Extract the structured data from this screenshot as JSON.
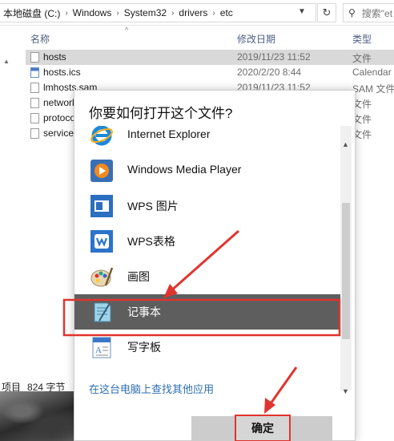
{
  "address": {
    "crumbs": [
      "本地磁盘 (C:)",
      "Windows",
      "System32",
      "drivers",
      "etc"
    ],
    "separator": "›",
    "dropdown_icon": "chevron-down",
    "refresh_icon": "refresh",
    "search_placeholder": "搜索\"et"
  },
  "columns": {
    "name": "名称",
    "date": "修改日期",
    "type": "类型",
    "sort_indicator": "^"
  },
  "files": [
    {
      "name": "hosts",
      "date": "2019/11/23 11:52",
      "type": "文件",
      "selected": true
    },
    {
      "name": "hosts.ics",
      "date": "2020/2/20 8:44",
      "type": "Calendar"
    },
    {
      "name": "lmhosts.sam",
      "date": "2019/11/23 11:52",
      "type": "SAM 文件"
    },
    {
      "name": "networks",
      "date": "",
      "type": "文件"
    },
    {
      "name": "protocol",
      "date": "",
      "type": "文件"
    },
    {
      "name": "services",
      "date": "",
      "type": "文件"
    }
  ],
  "status": {
    "items": "项目",
    "selected": "824 字节"
  },
  "dialog": {
    "title": "你要如何打开这个文件?",
    "apps": [
      {
        "label": "Internet Explorer",
        "icon": "internet-explorer-icon"
      },
      {
        "label": "Windows Media Player",
        "icon": "media-player-icon"
      },
      {
        "label": "WPS 图片",
        "icon": "wps-picture-icon"
      },
      {
        "label": "WPS表格",
        "icon": "wps-sheet-icon"
      },
      {
        "label": "画图",
        "icon": "paint-icon"
      },
      {
        "label": "记事本",
        "icon": "notepad-icon",
        "selected": true
      },
      {
        "label": "写字板",
        "icon": "wordpad-icon"
      }
    ],
    "more_apps_link": "在这台电脑上查找其他应用",
    "ok_label": "确定"
  },
  "colors": {
    "accent_link": "#2f6fb3",
    "highlight_red": "#e0342e",
    "selected_row": "#5e5e5e"
  }
}
